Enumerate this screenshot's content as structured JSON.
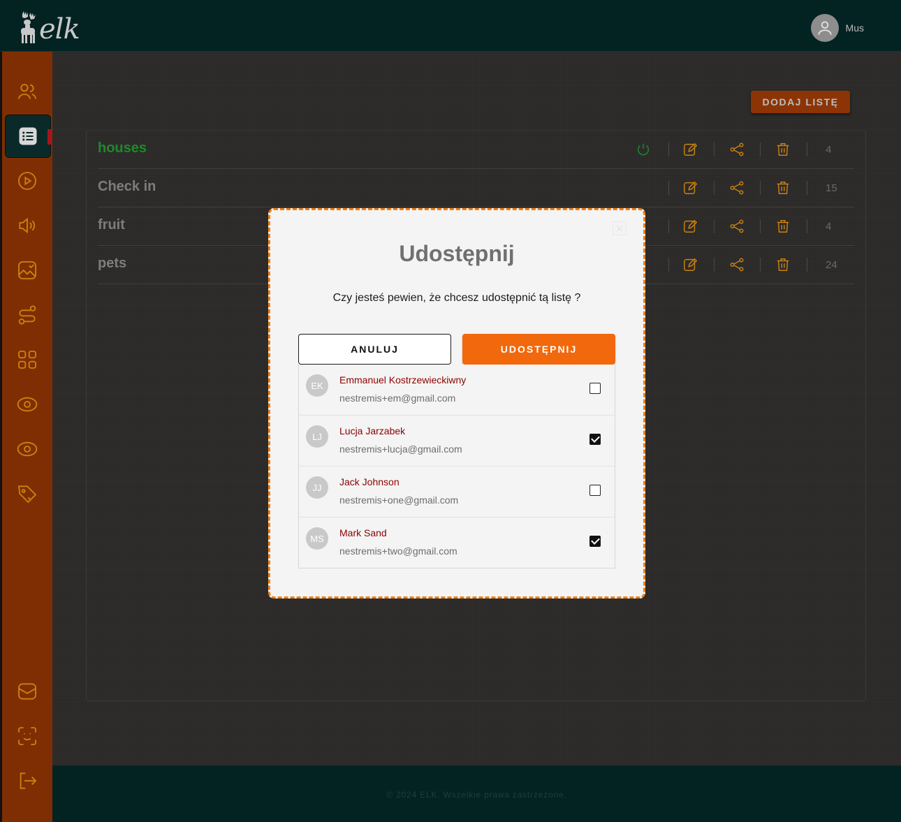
{
  "app": {
    "logo_text": "elk"
  },
  "header": {
    "user_name": "Mus"
  },
  "sidebar": {
    "items": [
      {
        "icon": "users-icon"
      },
      {
        "icon": "list-icon",
        "active": true
      },
      {
        "icon": "play-circle-icon"
      },
      {
        "icon": "speaker-icon"
      },
      {
        "icon": "image-check-icon"
      },
      {
        "icon": "route-icon"
      },
      {
        "icon": "apps-grid-icon"
      },
      {
        "icon": "eye-icon"
      },
      {
        "icon": "eye-icon"
      },
      {
        "icon": "tag-icon"
      }
    ],
    "bottom_items": [
      {
        "icon": "mail-icon"
      },
      {
        "icon": "face-scan-icon"
      },
      {
        "icon": "logout-icon"
      }
    ]
  },
  "main": {
    "add_list_label": "DODAJ LISTĘ",
    "lists": [
      {
        "name": "houses",
        "count": "4",
        "active": true
      },
      {
        "name": "Check in",
        "count": "15",
        "active": false
      },
      {
        "name": "fruit",
        "count": "4",
        "active": false
      },
      {
        "name": "pets",
        "count": "24",
        "active": false
      }
    ]
  },
  "footer": {
    "text": "© 2024 ELK. Wszelkie prawa zastrzeżone."
  },
  "modal": {
    "title": "Udostępnij",
    "question": "Czy jesteś pewien, że chcesz udostępnić tą listę ?",
    "cancel_label": "ANULUJ",
    "share_label": "UDOSTĘPNIJ",
    "users": [
      {
        "initials": "EK",
        "name": "Emmanuel Kostrzewieckiwny",
        "email": "nestremis+em@gmail.com",
        "checked": false
      },
      {
        "initials": "LJ",
        "name": "Lucja Jarzabek",
        "email": "nestremis+lucja@gmail.com",
        "checked": true
      },
      {
        "initials": "JJ",
        "name": "Jack Johnson",
        "email": "nestremis+one@gmail.com",
        "checked": false
      },
      {
        "initials": "MS",
        "name": "Mark Sand",
        "email": "nestremis+two@gmail.com",
        "checked": true
      }
    ]
  },
  "colors": {
    "sidebar": "#7f2e03",
    "header": "#032322",
    "accent": "#f2680c",
    "active_list": "#1e8a2a",
    "icon_orange": "#c9820f"
  }
}
